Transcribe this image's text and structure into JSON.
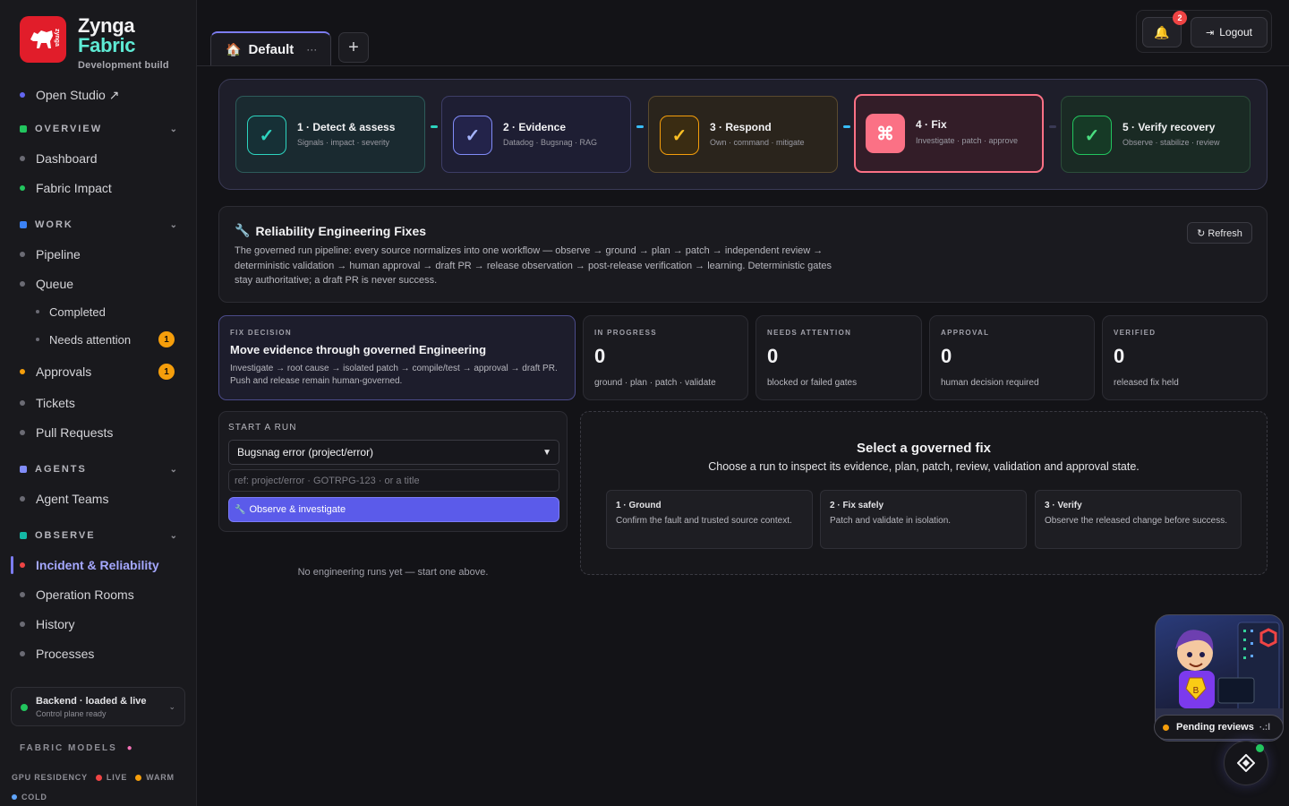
{
  "brand": {
    "name_line1": "Zynga",
    "name_line2": "Fabric",
    "subtitle": "Development build",
    "logo_text": "zynga"
  },
  "sidebar": {
    "open_studio": "Open Studio ↗",
    "sections": {
      "overview": {
        "label": "OVERVIEW",
        "color": "#22c55e"
      },
      "work": {
        "label": "WORK",
        "color": "#3b82f6"
      },
      "agents": {
        "label": "AGENTS",
        "color": "#818cf8"
      },
      "observe": {
        "label": "OBSERVE",
        "color": "#14b8a6"
      }
    },
    "items": {
      "dashboard": "Dashboard",
      "fabric_impact": "Fabric Impact",
      "pipeline": "Pipeline",
      "queue": "Queue",
      "completed": "Completed",
      "needs_attention": "Needs attention",
      "needs_attention_count": "1",
      "approvals": "Approvals",
      "approvals_count": "1",
      "tickets": "Tickets",
      "pull_requests": "Pull Requests",
      "agent_teams": "Agent Teams",
      "incident_reliability": "Incident & Reliability",
      "operation_rooms": "Operation Rooms",
      "history": "History",
      "processes": "Processes"
    },
    "backend": {
      "title": "Backend · loaded & live",
      "subtitle": "Control plane ready"
    },
    "fabric_models": "FABRIC MODELS",
    "gpu_residency": {
      "label": "GPU RESIDENCY",
      "live": "LIVE",
      "warm": "WARM",
      "cold": "COLD"
    }
  },
  "topbar": {
    "tab_label": "Default",
    "tab_more": "···",
    "add_tab": "+",
    "notifications_count": "2",
    "logout": "Logout"
  },
  "stepper": [
    {
      "title": "1 · Detect & assess",
      "subtitle": "Signals · impact · severity",
      "icon": "check-icon",
      "color": "#2dd4bf"
    },
    {
      "title": "2 · Evidence",
      "subtitle": "Datadog · Bugsnag · RAG",
      "icon": "check-icon",
      "color": "#818cf8"
    },
    {
      "title": "3 · Respond",
      "subtitle": "Own · command · mitigate",
      "icon": "check-icon",
      "color": "#f59e0b"
    },
    {
      "title": "4 · Fix",
      "subtitle": "Investigate · patch · approve",
      "icon": "command-icon",
      "color": "#fb7185"
    },
    {
      "title": "5 · Verify recovery",
      "subtitle": "Observe · stabilize · review",
      "icon": "check-icon",
      "color": "#22c55e"
    }
  ],
  "reliability": {
    "title": "Reliability Engineering Fixes",
    "description": "The governed run pipeline: every source normalizes into one workflow — observe → ground → plan → patch → independent review → deterministic validation → human approval → draft PR → release observation → post-release verification → learning. Deterministic gates stay authoritative; a draft PR is never success.",
    "refresh": "↻ Refresh"
  },
  "decision": {
    "label": "FIX DECISION",
    "title": "Move evidence through governed Engineering",
    "body": "Investigate → root cause → isolated patch → compile/test → approval → draft PR. Push and release remain human-governed."
  },
  "stats": [
    {
      "label": "IN PROGRESS",
      "value": "0",
      "sub": "ground · plan · patch · validate"
    },
    {
      "label": "NEEDS ATTENTION",
      "value": "0",
      "sub": "blocked or failed gates"
    },
    {
      "label": "APPROVAL",
      "value": "0",
      "sub": "human decision required"
    },
    {
      "label": "VERIFIED",
      "value": "0",
      "sub": "released fix held"
    }
  ],
  "run": {
    "label": "START A RUN",
    "source_selected": "Bugsnag error (project/error)",
    "ref_placeholder": "ref: project/error · GOTRPG-123 · or a title",
    "button": "Observe & investigate",
    "empty": "No engineering runs yet — start one above."
  },
  "select_fix": {
    "title": "Select a governed fix",
    "subtitle": "Choose a run to inspect its evidence, plan, patch, review, validation and approval state.",
    "phases": [
      {
        "title": "1 · Ground",
        "body": "Confirm the fault and trusted source context."
      },
      {
        "title": "2 · Fix safely",
        "body": "Patch and validate in isolation."
      },
      {
        "title": "3 · Verify",
        "body": "Observe the released change before success."
      }
    ]
  },
  "assistant": {
    "pending": "Pending reviews",
    "pending_more": "·.:l"
  }
}
